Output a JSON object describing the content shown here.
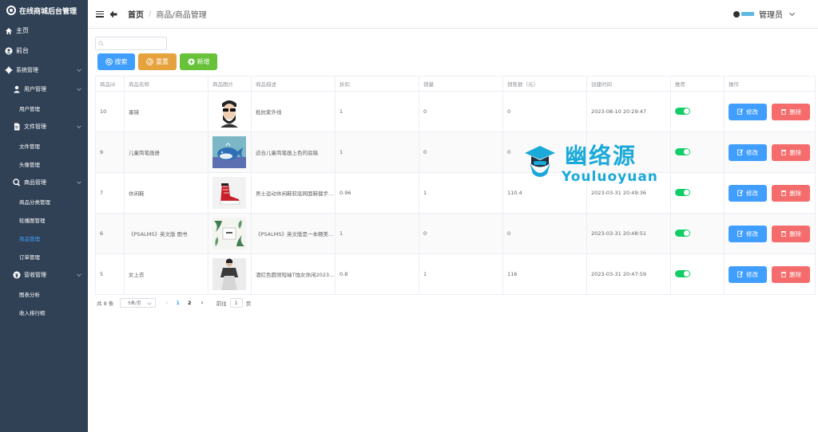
{
  "app": {
    "title": "在线商城后台管理"
  },
  "sidebar": {
    "items": [
      {
        "label": "主页",
        "icon": "home-icon"
      },
      {
        "label": "前台",
        "icon": "user-circle-icon"
      },
      {
        "label": "系统管理",
        "icon": "gear-icon"
      },
      {
        "label": "用户管理",
        "icon": "user-admin-icon"
      },
      {
        "label": "用户管理"
      },
      {
        "label": "文件管理",
        "icon": "document-icon"
      },
      {
        "label": "文件管理"
      },
      {
        "label": "头像管理"
      },
      {
        "label": "商品管理",
        "icon": "search-icon"
      },
      {
        "label": "商品分类管理"
      },
      {
        "label": "轮播图管理"
      },
      {
        "label": "商品管理"
      },
      {
        "label": "订单管理"
      },
      {
        "label": "营收管理",
        "icon": "money-icon"
      },
      {
        "label": "图表分析"
      },
      {
        "label": "收入排行榜"
      }
    ]
  },
  "header": {
    "home": "首页",
    "sep": "/",
    "current": "商品/商品管理",
    "user": "管理员"
  },
  "toolbar": {
    "search_placeholder": "",
    "search_label": "搜索",
    "reset_label": "重置",
    "add_label": "新增"
  },
  "table": {
    "columns": [
      "商品id",
      "商品名称",
      "商品图片",
      "商品描述",
      "折扣",
      "销量",
      "销售额（元）",
      "创建时间",
      "推荐",
      "操作"
    ],
    "edit_label": "修改",
    "delete_label": "删除",
    "rows": [
      {
        "id": "10",
        "name": "墨镜",
        "image": "sunglasses-man",
        "desc": "抵抗紫外线",
        "discount": "1",
        "sales": "0",
        "revenue": "0",
        "created": "2023-08-10  20:29:47",
        "recommend": true
      },
      {
        "id": "9",
        "name": "儿童简笔画册",
        "image": "whale-drawing",
        "desc": "适合儿童简笔画上色的底稿",
        "discount": "1",
        "sales": "0",
        "revenue": "0",
        "created": "",
        "recommend": true
      },
      {
        "id": "7",
        "name": "休闲鞋",
        "image": "red-sneaker",
        "desc": "男士运动休闲鞋软底网面鞋健步...",
        "discount": "0.96",
        "sales": "1",
        "revenue": "110.4",
        "created": "2023-03-31  20:49:36",
        "recommend": true
      },
      {
        "id": "6",
        "name": "《PSALMS》英文版 图书",
        "image": "book-leaves",
        "desc": "《PSALMS》英文版是一本精美...",
        "discount": "1",
        "sales": "0",
        "revenue": "0",
        "created": "2023-03-31  20:48:51",
        "recommend": true
      },
      {
        "id": "5",
        "name": "女上衣",
        "image": "woman-top",
        "desc": "酒红色圆领短袖T恤女休闲2023...",
        "discount": "0.8",
        "sales": "1",
        "revenue": "116",
        "created": "2023-03-31  20:47:59",
        "recommend": true
      }
    ]
  },
  "pagination": {
    "total": "共 8 条",
    "page_size": "5条/页",
    "prev": "‹",
    "pages": [
      "1",
      "2"
    ],
    "next": "›",
    "goto_label": "前往",
    "goto_value": "1",
    "unit": "页"
  },
  "watermark": {
    "cn": "幽络源",
    "en": "Youluoyuan"
  },
  "colors": {
    "primary": "#409eff",
    "warning": "#e6a23c",
    "success": "#67c23a",
    "danger": "#f56c6c",
    "sidebar": "#304156"
  }
}
